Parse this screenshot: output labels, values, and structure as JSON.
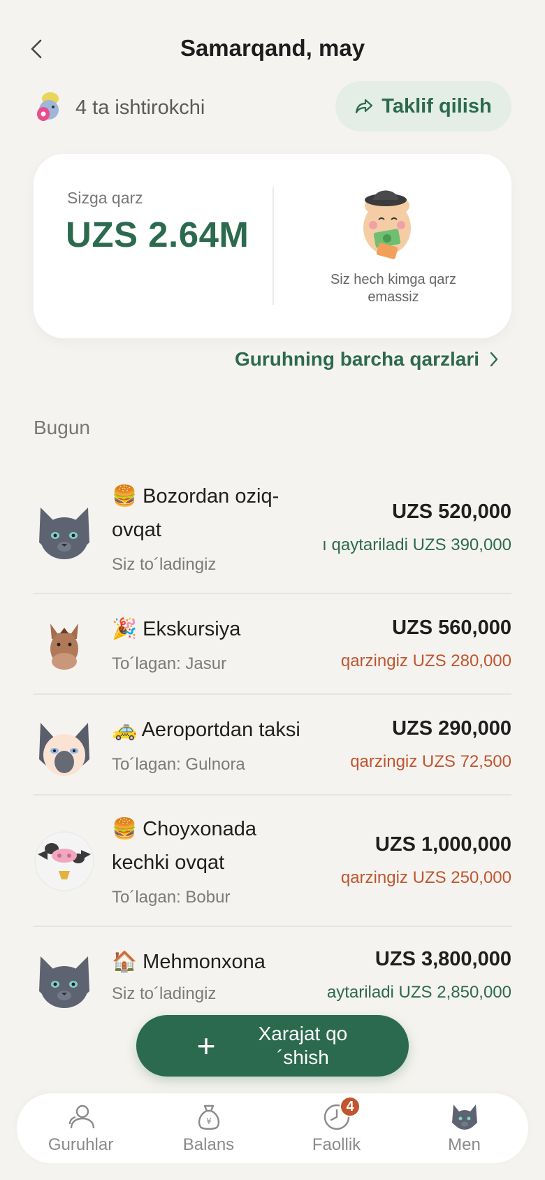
{
  "header": {
    "title": "Samarqand, may"
  },
  "participants": {
    "text": "4 ta ishtirokchi"
  },
  "invite": {
    "label": "Taklif qilish"
  },
  "summary": {
    "owed_label": "Sizga qarz",
    "owed_amount": "UZS 2.64M",
    "no_debt_text": "Siz hech kimga qarz emassiz"
  },
  "all_debts": {
    "label": "Guruhning barcha qarzlari"
  },
  "section": {
    "label": "Bugun"
  },
  "expenses": [
    {
      "emoji": "🍔",
      "name": "Bozordan oziq-ovqat",
      "payer": "Siz to´ladingiz",
      "total": "UZS 520,000",
      "delta": "ı qaytariladi UZS 390,000",
      "delta_color": "green",
      "avatar": "gray-cat-icon"
    },
    {
      "emoji": "🎉",
      "name": "Ekskursiya",
      "payer": "To´lagan: Jasur",
      "total": "UZS 560,000",
      "delta": "qarzingiz UZS 280,000",
      "delta_color": "red",
      "avatar": "horse-icon"
    },
    {
      "emoji": "🚕",
      "name": "Aeroportdan taksi",
      "payer": "To´lagan: Gulnora",
      "total": "UZS 290,000",
      "delta": "qarzingiz UZS 72,500",
      "delta_color": "red",
      "avatar": "siamese-cat-icon"
    },
    {
      "emoji": "🍔",
      "name": "Choyxonada kechki ovqat",
      "payer": "To´lagan: Bobur",
      "total": "UZS 1,000,000",
      "delta": "qarzingiz UZS 250,000",
      "delta_color": "red",
      "avatar": "cow-icon"
    },
    {
      "emoji": "🏠",
      "name": "Mehmonxona",
      "payer": "Siz to´ladingiz",
      "total": "UZS 3,800,000",
      "delta": "aytariladi UZS 2,850,000",
      "delta_color": "green",
      "avatar": "gray-cat-icon"
    }
  ],
  "add_expense": {
    "label": "Xarajat qo´shish"
  },
  "nav": [
    {
      "label": "Guruhlar",
      "icon": "people-icon"
    },
    {
      "label": "Balans",
      "icon": "money-bag-icon"
    },
    {
      "label": "Faollik",
      "icon": "clock-icon",
      "badge": "4"
    },
    {
      "label": "Men",
      "icon": "cat-avatar-icon"
    }
  ],
  "colors": {
    "accent": "#2c6a4f",
    "debt": "#c0552f",
    "background": "#f5f3ef"
  }
}
